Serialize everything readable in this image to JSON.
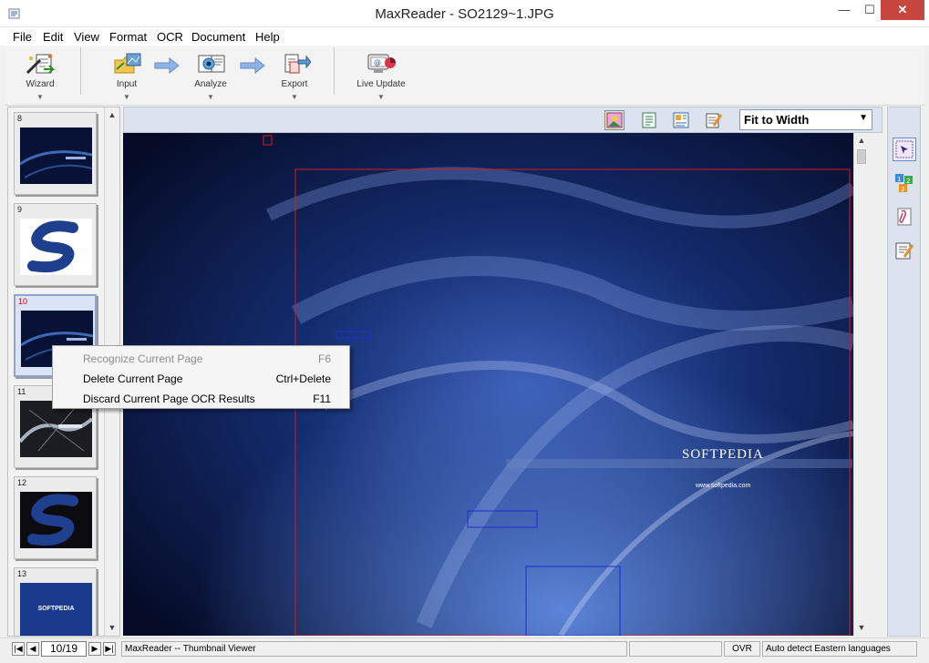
{
  "window": {
    "title": "MaxReader - SO2129~1.JPG",
    "minimize_glyph": "—",
    "maximize_glyph": "☐",
    "close_glyph": "✕"
  },
  "menu": [
    "File",
    "Edit",
    "View",
    "Format",
    "OCR",
    "Document",
    "Help"
  ],
  "toolbar": {
    "wizard": "Wizard",
    "input": "Input",
    "analyze": "Analyze",
    "export": "Export",
    "live_update": "Live Update"
  },
  "thumbnails": [
    {
      "num": "8",
      "kind": "dark"
    },
    {
      "num": "9",
      "kind": "logo-white"
    },
    {
      "num": "10",
      "kind": "dark",
      "selected": true
    },
    {
      "num": "11",
      "kind": "gray"
    },
    {
      "num": "12",
      "kind": "logo-dark"
    },
    {
      "num": "13",
      "kind": "softpedia",
      "label": "SOFTPEDIA"
    }
  ],
  "viewer": {
    "zoom": "Fit to Width",
    "image_brand": "SOFTPEDIA",
    "image_url": "www.softpedia.com"
  },
  "context_menu": [
    {
      "label": "Recognize Current Page",
      "shortcut": "F6",
      "enabled": false
    },
    {
      "label": "Delete Current Page",
      "shortcut": "Ctrl+Delete",
      "enabled": true
    },
    {
      "label": "Discard Current Page OCR Results",
      "shortcut": "F11",
      "enabled": true
    }
  ],
  "status": {
    "page": "10/19",
    "message": "MaxReader -- Thumbnail Viewer",
    "mode": "OVR",
    "language": "Auto detect Eastern languages"
  },
  "colors": {
    "accent": "#6c8cc4",
    "close": "#c7463f",
    "viewer_bg": "#08102f"
  }
}
